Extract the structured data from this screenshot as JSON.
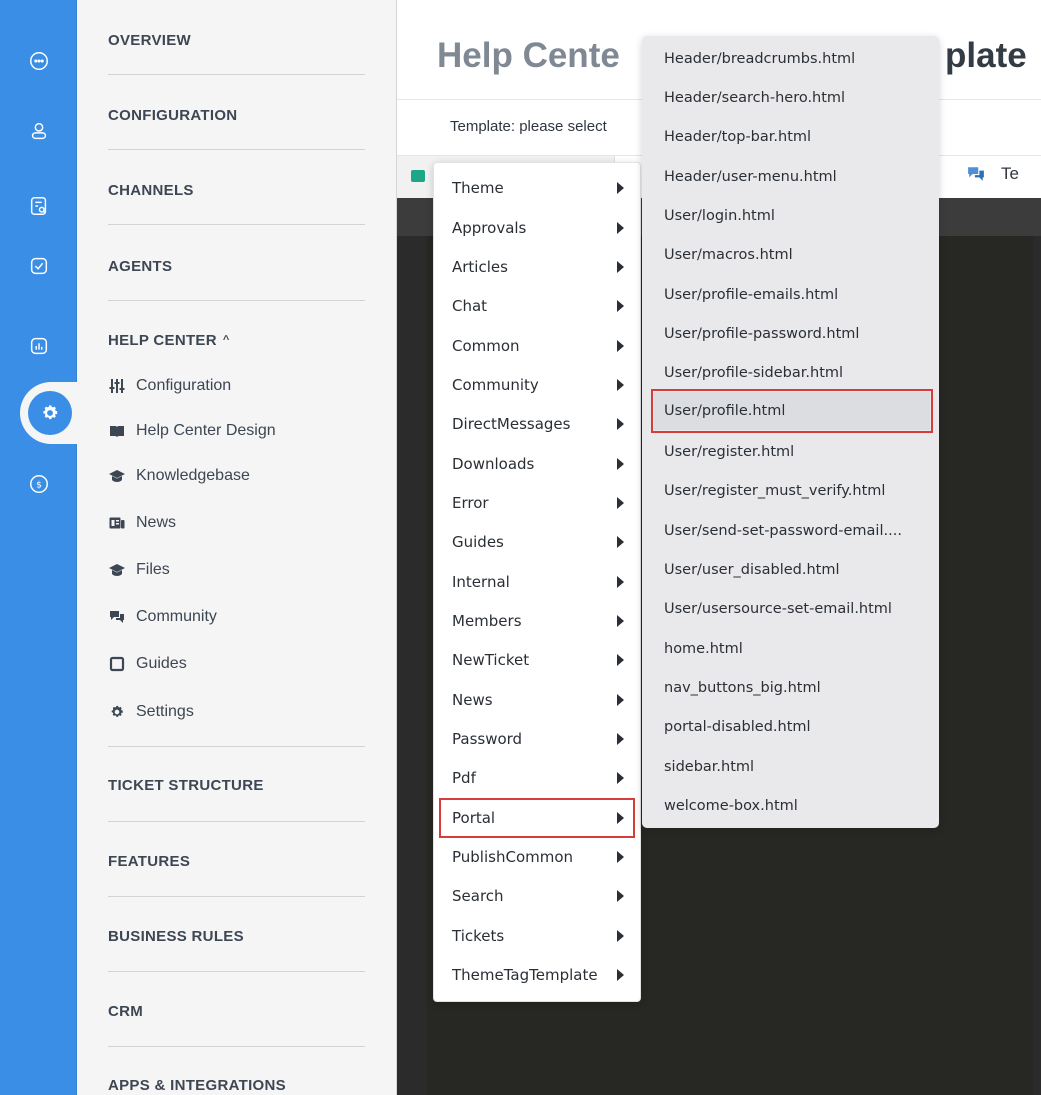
{
  "sidebar_rail": {
    "icons": [
      "chat-icon",
      "user-icon",
      "tickets-search-icon",
      "tasks-check-icon",
      "reports-chart-icon",
      "settings-gear-icon",
      "billing-dollar-icon"
    ],
    "active": "settings-gear-icon",
    "accent": "#3a8ee6"
  },
  "nav": {
    "overview": "OVERVIEW",
    "configuration": "CONFIGURATION",
    "channels": "CHANNELS",
    "agents": "AGENTS",
    "help_center": "HELP CENTER",
    "help_center_caret": "^",
    "help_center_items": [
      {
        "label": "Configuration",
        "icon": "sliders-icon"
      },
      {
        "label": "Help Center Design",
        "icon": "book-open-icon"
      },
      {
        "label": "Knowledgebase",
        "icon": "graduation-cap-icon"
      },
      {
        "label": "News",
        "icon": "newspaper-icon"
      },
      {
        "label": "Files",
        "icon": "graduation-cap-icon"
      },
      {
        "label": "Community",
        "icon": "comments-icon"
      },
      {
        "label": "Guides",
        "icon": "square-book-icon"
      },
      {
        "label": "Settings",
        "icon": "cog-icon"
      }
    ],
    "ticket_structure": "TICKET STRUCTURE",
    "features": "FEATURES",
    "business_rules": "BUSINESS RULES",
    "crm": "CRM",
    "apps_integrations": "APPS & INTEGRATIONS"
  },
  "main": {
    "title_left": "Help Cente",
    "title_right": "plate",
    "template_label": "Template:  please select",
    "tab_test_label": "Te"
  },
  "menu": {
    "items": [
      "Theme",
      "Approvals",
      "Articles",
      "Chat",
      "Common",
      "Community",
      "DirectMessages",
      "Downloads",
      "Error",
      "Guides",
      "Internal",
      "Members",
      "NewTicket",
      "News",
      "Password",
      "Pdf",
      "Portal",
      "PublishCommon",
      "Search",
      "Tickets",
      "ThemeTagTemplate"
    ],
    "selected": "Portal"
  },
  "submenu": {
    "items": [
      "Header/breadcrumbs.html",
      "Header/search-hero.html",
      "Header/top-bar.html",
      "Header/user-menu.html",
      "User/login.html",
      "User/macros.html",
      "User/profile-emails.html",
      "User/profile-password.html",
      "User/profile-sidebar.html",
      "User/profile.html",
      "User/register.html",
      "User/register_must_verify.html",
      "User/send-set-password-email....",
      "User/user_disabled.html",
      "User/usersource-set-email.html",
      "home.html",
      "nav_buttons_big.html",
      "portal-disabled.html",
      "sidebar.html",
      "welcome-box.html"
    ],
    "highlighted": "User/profile.html"
  }
}
